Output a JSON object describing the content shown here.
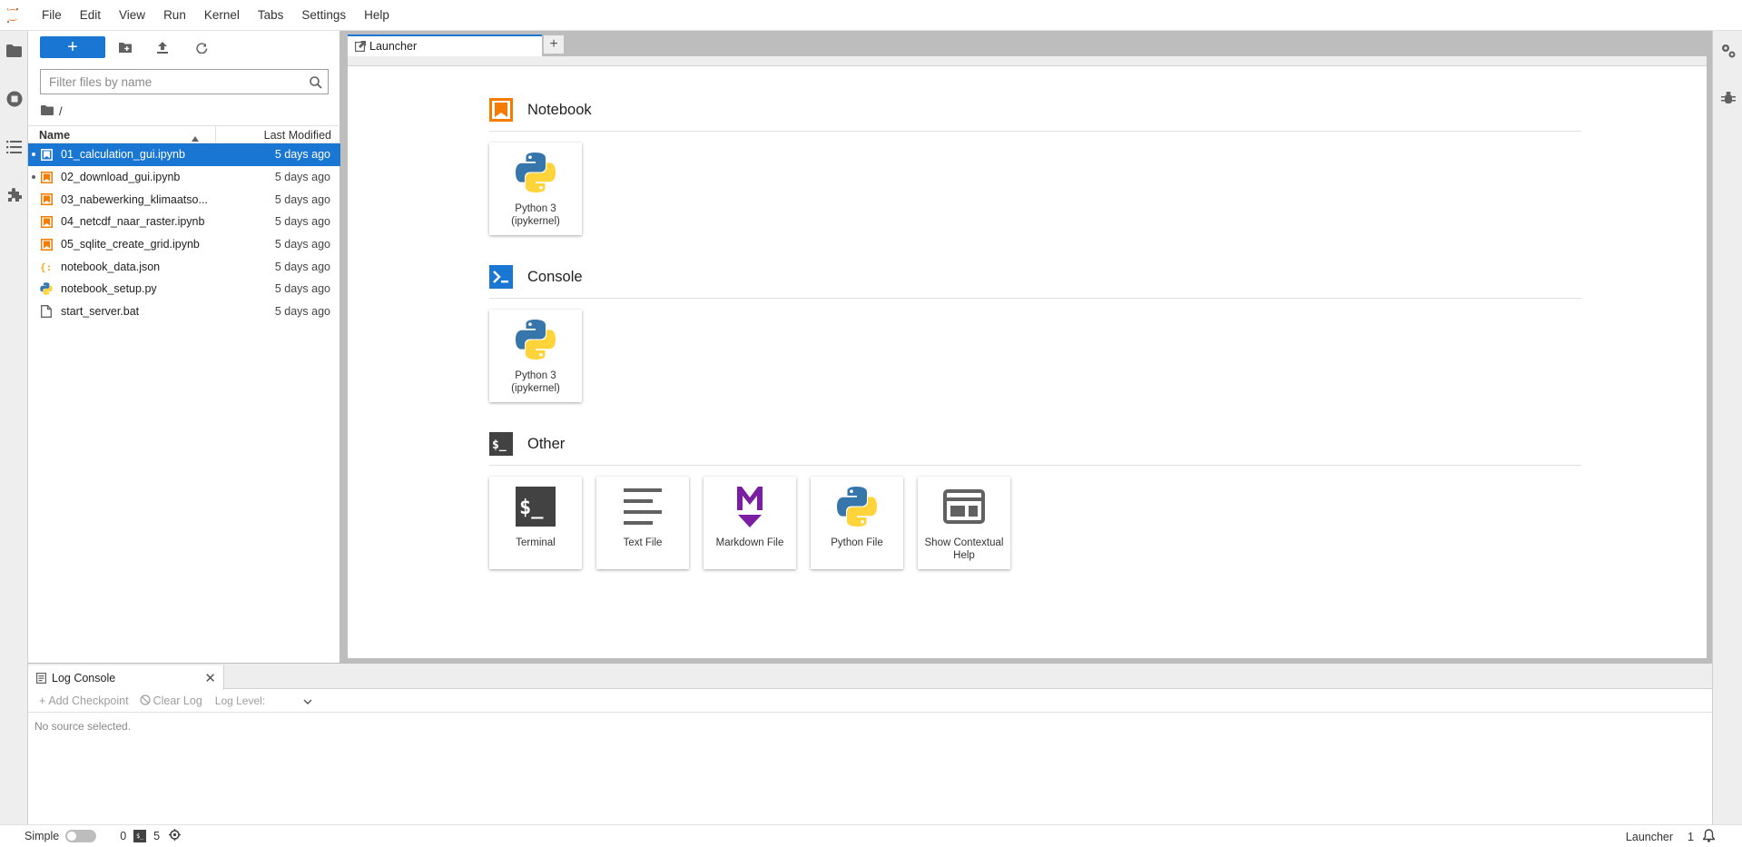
{
  "menu": {
    "items": [
      "File",
      "Edit",
      "View",
      "Run",
      "Kernel",
      "Tabs",
      "Settings",
      "Help"
    ]
  },
  "leftbar": {
    "icons": [
      "folder-icon",
      "running-icon",
      "toc-icon",
      "extension-icon"
    ]
  },
  "rightbar": {
    "icons": [
      "property-inspector-icon",
      "debugger-icon"
    ]
  },
  "filebrowser": {
    "new_label": "+",
    "filter_placeholder": "Filter files by name",
    "breadcrumb": "/",
    "header_name": "Name",
    "header_modified": "Last Modified",
    "files": [
      {
        "name": "01_calculation_gui.ipynb",
        "modified": "5 days ago",
        "type": "notebook",
        "running": true,
        "selected": true
      },
      {
        "name": "02_download_gui.ipynb",
        "modified": "5 days ago",
        "type": "notebook",
        "running": true,
        "selected": false
      },
      {
        "name": "03_nabewerking_klimaatso...",
        "modified": "5 days ago",
        "type": "notebook",
        "running": false,
        "selected": false
      },
      {
        "name": "04_netcdf_naar_raster.ipynb",
        "modified": "5 days ago",
        "type": "notebook",
        "running": false,
        "selected": false
      },
      {
        "name": "05_sqlite_create_grid.ipynb",
        "modified": "5 days ago",
        "type": "notebook",
        "running": false,
        "selected": false
      },
      {
        "name": "notebook_data.json",
        "modified": "5 days ago",
        "type": "json",
        "running": false,
        "selected": false
      },
      {
        "name": "notebook_setup.py",
        "modified": "5 days ago",
        "type": "python",
        "running": false,
        "selected": false
      },
      {
        "name": "start_server.bat",
        "modified": "5 days ago",
        "type": "file",
        "running": false,
        "selected": false
      }
    ]
  },
  "tabs": {
    "active_label": "Launcher",
    "add_label": "+"
  },
  "launcher": {
    "sections": [
      {
        "title": "Notebook",
        "icon": "notebook-icon",
        "cards": [
          {
            "label": "Python 3 (ipykernel)",
            "icon": "python-icon"
          }
        ]
      },
      {
        "title": "Console",
        "icon": "console-icon",
        "cards": [
          {
            "label": "Python 3 (ipykernel)",
            "icon": "python-icon"
          }
        ]
      },
      {
        "title": "Other",
        "icon": "terminal-section-icon",
        "cards": [
          {
            "label": "Terminal",
            "icon": "terminal-icon"
          },
          {
            "label": "Text File",
            "icon": "text-file-icon"
          },
          {
            "label": "Markdown File",
            "icon": "markdown-icon"
          },
          {
            "label": "Python File",
            "icon": "python-icon"
          },
          {
            "label": "Show Contextual Help",
            "icon": "help-icon"
          }
        ]
      }
    ]
  },
  "log_console": {
    "tab_label": "Log Console",
    "add_checkpoint": "Add Checkpoint",
    "clear_log": "Clear Log",
    "log_level": "Log Level:",
    "body": "No source selected."
  },
  "statusbar": {
    "simple_label": "Simple",
    "kernels_count": "0",
    "terminals_count": "5",
    "mode": "Launcher",
    "count": "1"
  },
  "colors": {
    "accent": "#1976d2",
    "notebook_orange": "#f57c00",
    "markdown_purple": "#7b1fa2"
  }
}
